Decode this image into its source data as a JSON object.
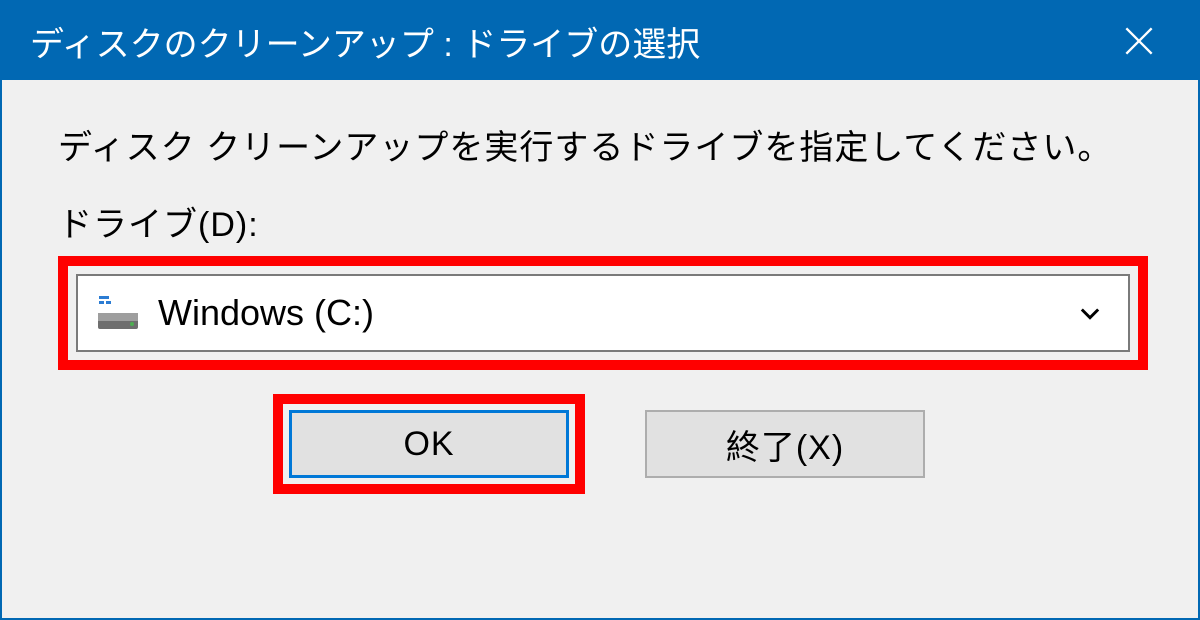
{
  "titlebar": {
    "title": "ディスクのクリーンアップ : ドライブの選択"
  },
  "content": {
    "instruction": "ディスク クリーンアップを実行するドライブを指定してください。",
    "drive_label": "ドライブ(D):",
    "selected_drive": "Windows (C:)"
  },
  "buttons": {
    "ok": "OK",
    "exit": "終了(X)"
  },
  "icons": {
    "close": "close-icon",
    "drive": "drive-icon",
    "chevron": "chevron-down-icon"
  },
  "highlights": {
    "dropdown": true,
    "ok_button": true
  }
}
